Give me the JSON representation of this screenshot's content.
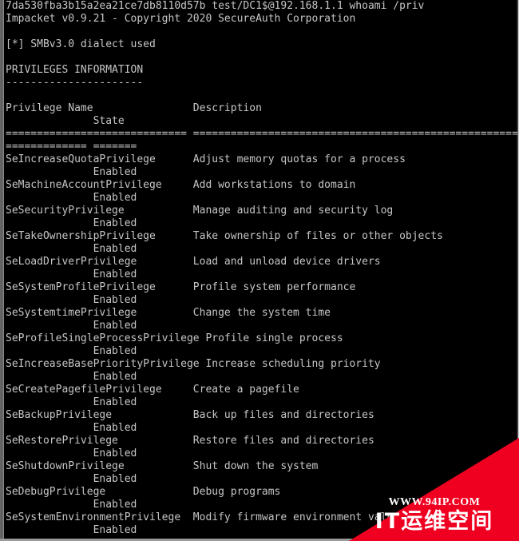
{
  "terminal": {
    "colors": {
      "background": "#000000",
      "foreground": "#c6c6c6",
      "watermark_red": "#f00020",
      "watermark_text": "#ffffff"
    },
    "lines": [
      "7da530fba3b15a2ea21ce7db8110d57b test/DC1$@192.168.1.1 whoami /priv",
      "Impacket v0.9.21 - Copyright 2020 SecureAuth Corporation",
      "",
      "[*] SMBv3.0 dialect used",
      "",
      "PRIVILEGES INFORMATION",
      "----------------------",
      "",
      "Privilege Name                Description",
      "              State",
      "============================= =====================================================",
      "============= =======",
      "SeIncreaseQuotaPrivilege      Adjust memory quotas for a process",
      "              Enabled",
      "SeMachineAccountPrivilege     Add workstations to domain",
      "              Enabled",
      "SeSecurityPrivilege           Manage auditing and security log",
      "              Enabled",
      "SeTakeOwnershipPrivilege      Take ownership of files or other objects",
      "              Enabled",
      "SeLoadDriverPrivilege         Load and unload device drivers",
      "              Enabled",
      "SeSystemProfilePrivilege      Profile system performance",
      "              Enabled",
      "SeSystemtimePrivilege         Change the system time",
      "              Enabled",
      "SeProfileSingleProcessPrivilege Profile single process",
      "              Enabled",
      "SeIncreaseBasePriorityPrivilege Increase scheduling priority",
      "              Enabled",
      "SeCreatePagefilePrivilege     Create a pagefile",
      "              Enabled",
      "SeBackupPrivilege             Back up files and directories",
      "              Enabled",
      "SeRestorePrivilege            Restore files and directories",
      "              Enabled",
      "SeShutdownPrivilege           Shut down the system",
      "              Enabled",
      "SeDebugPrivilege              Debug programs",
      "              Enabled",
      "SeSystemEnvironmentPrivilege  Modify firmware environment values",
      "              Enabled"
    ],
    "command": {
      "hash": "7da530fba3b15a2ea21ce7db8110d57b",
      "target": "test/DC1$@192.168.1.1",
      "program": "whoami",
      "argument": "/priv"
    },
    "banner": {
      "tool": "Impacket",
      "version": "v0.9.21",
      "copyright": "- Copyright 2020 SecureAuth Corporation"
    },
    "status_line": "[*] SMBv3.0 dialect used",
    "section_title": "PRIVILEGES INFORMATION",
    "table": {
      "headers": [
        "Privilege Name",
        "Description",
        "State"
      ],
      "rows": [
        {
          "name": "SeIncreaseQuotaPrivilege",
          "description": "Adjust memory quotas for a process",
          "state": "Enabled"
        },
        {
          "name": "SeMachineAccountPrivilege",
          "description": "Add workstations to domain",
          "state": "Enabled"
        },
        {
          "name": "SeSecurityPrivilege",
          "description": "Manage auditing and security log",
          "state": "Enabled"
        },
        {
          "name": "SeTakeOwnershipPrivilege",
          "description": "Take ownership of files or other objects",
          "state": "Enabled"
        },
        {
          "name": "SeLoadDriverPrivilege",
          "description": "Load and unload device drivers",
          "state": "Enabled"
        },
        {
          "name": "SeSystemProfilePrivilege",
          "description": "Profile system performance",
          "state": "Enabled"
        },
        {
          "name": "SeSystemtimePrivilege",
          "description": "Change the system time",
          "state": "Enabled"
        },
        {
          "name": "SeProfileSingleProcessPrivilege",
          "description": "Profile single process",
          "state": "Enabled"
        },
        {
          "name": "SeIncreaseBasePriorityPrivilege",
          "description": "Increase scheduling priority",
          "state": "Enabled"
        },
        {
          "name": "SeCreatePagefilePrivilege",
          "description": "Create a pagefile",
          "state": "Enabled"
        },
        {
          "name": "SeBackupPrivilege",
          "description": "Back up files and directories",
          "state": "Enabled"
        },
        {
          "name": "SeRestorePrivilege",
          "description": "Restore files and directories",
          "state": "Enabled"
        },
        {
          "name": "SeShutdownPrivilege",
          "description": "Shut down the system",
          "state": "Enabled"
        },
        {
          "name": "SeDebugPrivilege",
          "description": "Debug programs",
          "state": "Enabled"
        },
        {
          "name": "SeSystemEnvironmentPrivilege",
          "description": "Modify firmware environment values",
          "state": "Enabled"
        }
      ]
    }
  },
  "watermark": {
    "url": "WWW.94IP.COM",
    "site_name": "IT运维空间"
  }
}
